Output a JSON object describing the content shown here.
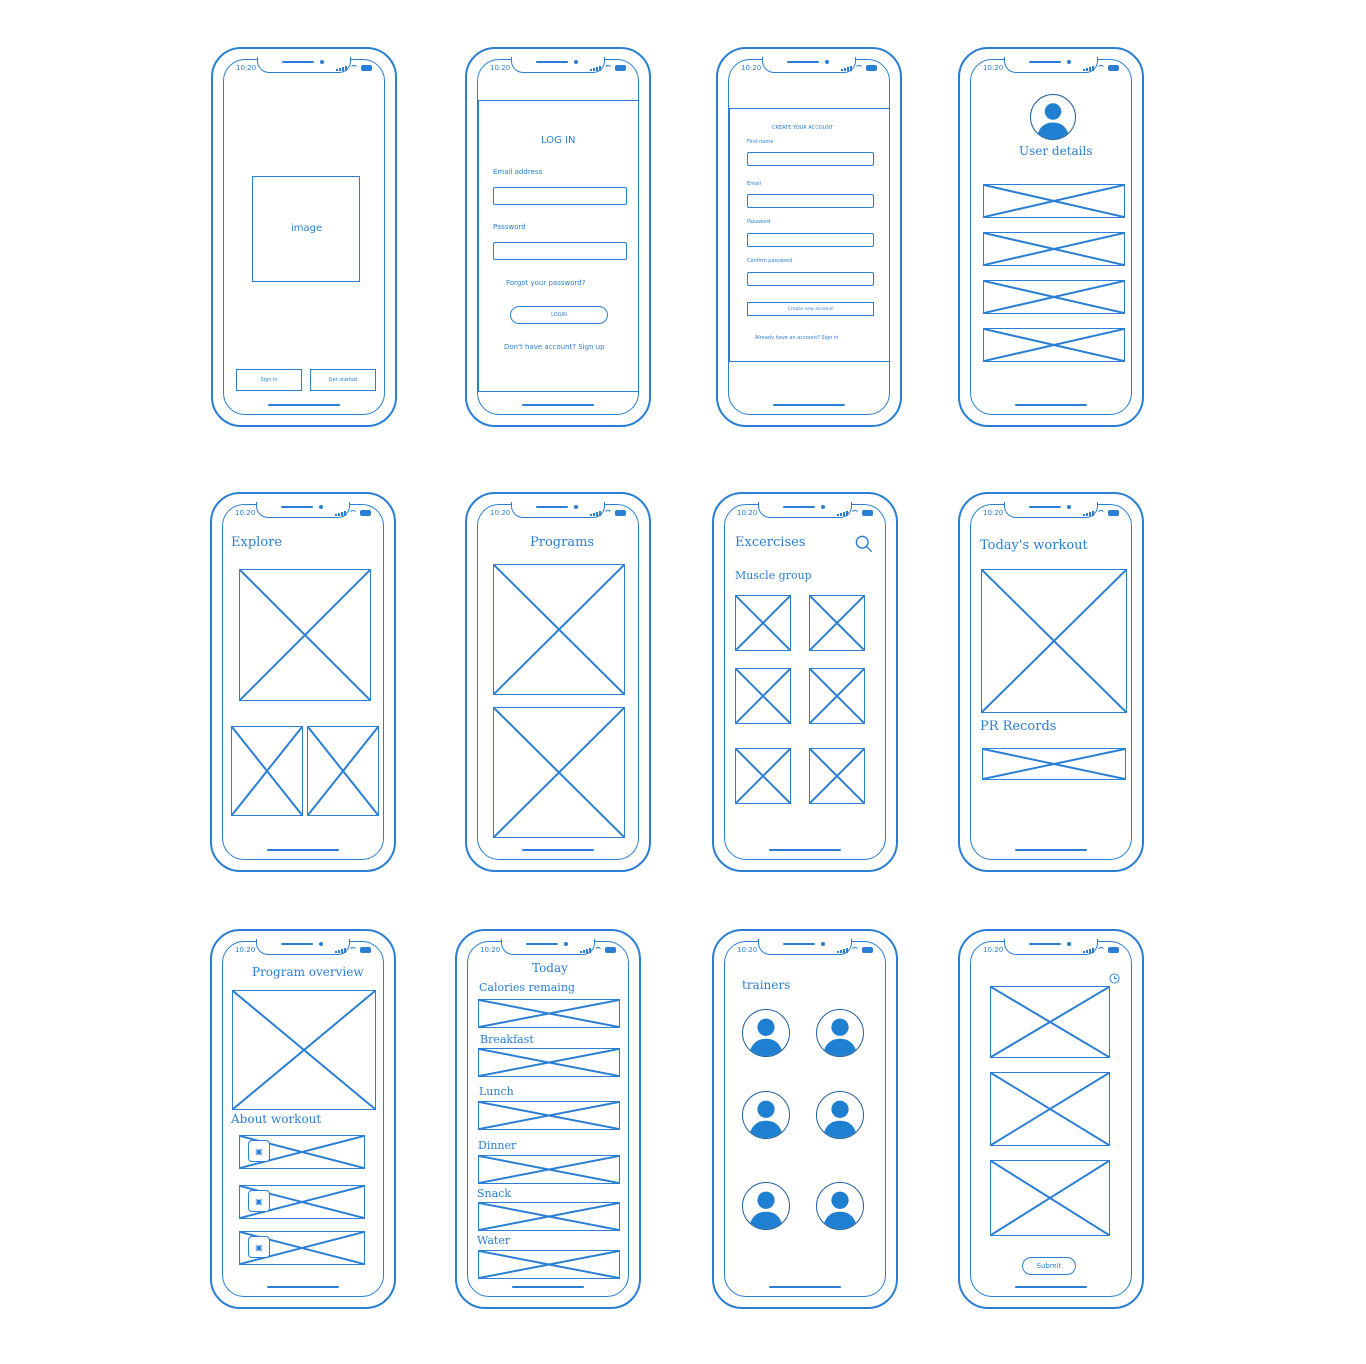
{
  "status_time": "10:20",
  "colors": {
    "stroke": "#2a7fd4",
    "avatar": "#1f7fd0",
    "background": "#ffffff"
  },
  "icons": [
    "signal-icon",
    "wifi-icon",
    "battery-icon",
    "search-icon",
    "clock-icon",
    "image-icon",
    "user-avatar-icon"
  ],
  "splash": {
    "image_label": "image",
    "sign_in": "Sign in",
    "get_started": "Get started"
  },
  "login": {
    "title": "LOG IN",
    "email_label": "Email address",
    "password_label": "Password",
    "forgot": "Forgot your password?",
    "login_button": "LOGIN",
    "signup_link": "Don't have account? Sign up"
  },
  "create_account": {
    "title": "CREATE YOUR ACCOUNT",
    "first_name": "First name",
    "email": "Email",
    "password": "Password",
    "confirm_password": "Confirm password",
    "button": "Create new account",
    "signin_link": "Already have an account? Sign in"
  },
  "user_details": {
    "title": "User details"
  },
  "explore": {
    "title": "Explore"
  },
  "programs": {
    "title": "Programs"
  },
  "exercises": {
    "title": "Excercises",
    "subtitle": "Muscle group"
  },
  "todays_workout": {
    "title": "Today's workout",
    "pr_records": "PR Records"
  },
  "program_overview": {
    "title": "Program overview",
    "about": "About workout"
  },
  "today": {
    "title": "Today",
    "sections": [
      "Calories remaing",
      "Breakfast",
      "Lunch",
      "Dinner",
      "Snack",
      "Water"
    ]
  },
  "trainers": {
    "title": "trainers"
  },
  "workout_log": {
    "submit": "Submit"
  }
}
